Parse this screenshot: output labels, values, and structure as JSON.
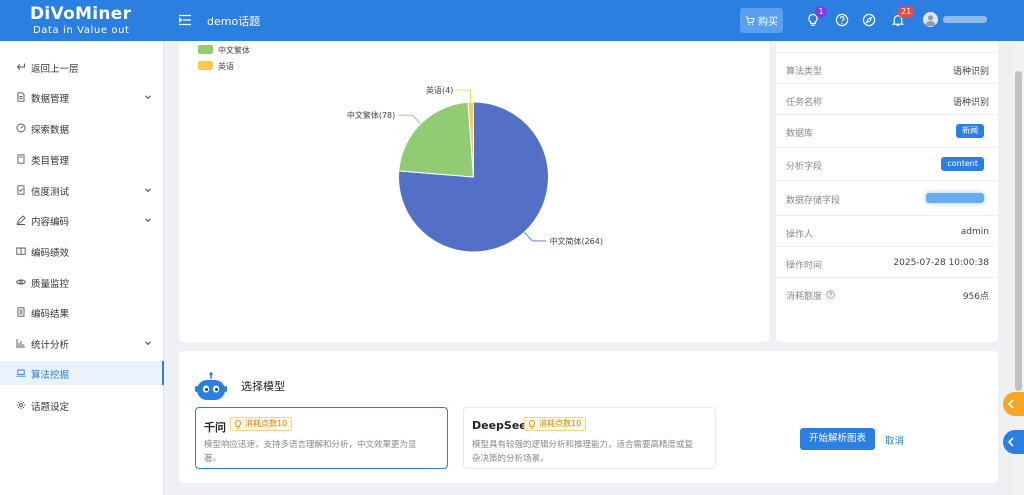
{
  "app": {
    "logo_text": "DiVoMiner",
    "logo_tagline": "Data in  Value out",
    "page_heading": "demo话题",
    "buy_label": "购买",
    "tips_badge": "1",
    "notifications_badge": "21",
    "accent_color": "#2b7fe0"
  },
  "sidebar": {
    "items": [
      {
        "label": "返回上一层",
        "icon": "return-icon"
      },
      {
        "label": "数据管理",
        "icon": "document-icon"
      },
      {
        "label": "探索数据",
        "icon": "gauge-icon"
      },
      {
        "label": "类目管理",
        "icon": "file-icon"
      },
      {
        "label": "信度测试",
        "icon": "checklist-icon"
      },
      {
        "label": "内容编码",
        "icon": "pen-icon"
      },
      {
        "label": "编码绩效",
        "icon": "book-icon"
      },
      {
        "label": "质量监控",
        "icon": "eye-icon"
      },
      {
        "label": "编码结果",
        "icon": "list-icon"
      },
      {
        "label": "统计分析",
        "icon": "bar-chart-icon"
      },
      {
        "label": "算法挖掘",
        "icon": "laptop-icon"
      },
      {
        "label": "话题设定",
        "icon": "gear-icon"
      }
    ],
    "active_index": 10
  },
  "chart_data": {
    "type": "pie",
    "title": "",
    "legend": [
      "中文繁体",
      "英语"
    ],
    "legend_placement": "top-left",
    "slices": [
      {
        "name": "中文简体",
        "value": 264,
        "label": "中文简体(264)",
        "color": "#5470c6"
      },
      {
        "name": "中文繁体",
        "value": 78,
        "label": "中文繁体(78)",
        "color": "#91cc75"
      },
      {
        "name": "英语",
        "value": 4,
        "label": "英语(4)",
        "color": "#fac858"
      }
    ]
  },
  "info": {
    "rows": [
      {
        "label": "算法类型",
        "value": "语种识别"
      },
      {
        "label": "任务名称",
        "value": "语种识别"
      },
      {
        "label": "数据库",
        "tag": "新闻"
      },
      {
        "label": "分析字段",
        "tag": "content"
      },
      {
        "label": "数据存储字段"
      },
      {
        "label": "操作人",
        "value": "admin"
      },
      {
        "label": "操作时间",
        "value": "2025-07-28 10:00:38"
      },
      {
        "label": "消耗额度",
        "value": "956点"
      }
    ]
  },
  "model_select": {
    "title": "选择模型",
    "options": [
      {
        "name": "千问",
        "cost": "消耗点数10",
        "desc_lines": [
          "模型响应迅速，支持多语言理解和分析，中文效果更为显",
          "著。"
        ],
        "selected": true
      },
      {
        "name": "DeepSeek",
        "cost": "消耗点数10",
        "desc_lines": [
          "模型具有较强的逻辑分析和推理能力，适合需要高精度或复",
          "杂决策的分析场景。"
        ],
        "selected": false
      }
    ],
    "start_label": "开始解析图表",
    "cancel_label": "取消"
  }
}
